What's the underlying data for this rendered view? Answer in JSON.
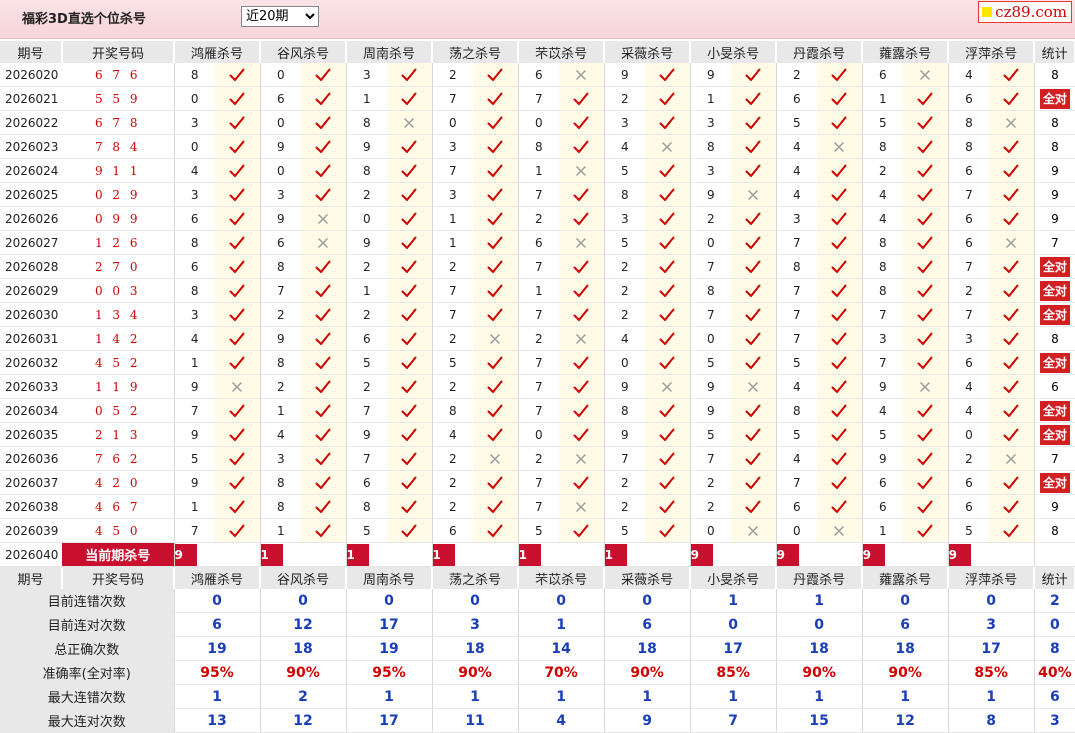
{
  "title": "福彩3D直选个位杀号",
  "period_select": {
    "selected": "近20期",
    "options": [
      "近20期"
    ]
  },
  "logo": {
    "text": "cz89.com"
  },
  "columns": {
    "issue": "期号",
    "draw": "开奖号码",
    "experts": [
      "鸿雁杀号",
      "谷风杀号",
      "周南杀号",
      "荡之杀号",
      "芣苡杀号",
      "采薇杀号",
      "小旻杀号",
      "丹霞杀号",
      "蕹露杀号",
      "浮萍杀号"
    ],
    "stat": "统计"
  },
  "rows": [
    {
      "issue": "2026020",
      "draw": "6 7 6",
      "kills": [
        8,
        0,
        3,
        2,
        6,
        9,
        9,
        2,
        6,
        4
      ],
      "ok": [
        1,
        1,
        1,
        1,
        0,
        1,
        1,
        1,
        0,
        1
      ],
      "stat": "8"
    },
    {
      "issue": "2026021",
      "draw": "5 5 9",
      "kills": [
        0,
        6,
        1,
        7,
        7,
        2,
        1,
        6,
        1,
        6
      ],
      "ok": [
        1,
        1,
        1,
        1,
        1,
        1,
        1,
        1,
        1,
        1
      ],
      "stat": "全对"
    },
    {
      "issue": "2026022",
      "draw": "6 7 8",
      "kills": [
        3,
        0,
        8,
        0,
        0,
        3,
        3,
        5,
        5,
        8
      ],
      "ok": [
        1,
        1,
        0,
        1,
        1,
        1,
        1,
        1,
        1,
        0
      ],
      "stat": "8"
    },
    {
      "issue": "2026023",
      "draw": "7 8 4",
      "kills": [
        0,
        9,
        9,
        3,
        8,
        4,
        8,
        4,
        8,
        8
      ],
      "ok": [
        1,
        1,
        1,
        1,
        1,
        0,
        1,
        0,
        1,
        1
      ],
      "stat": "8"
    },
    {
      "issue": "2026024",
      "draw": "9 1 1",
      "kills": [
        4,
        0,
        8,
        7,
        1,
        5,
        3,
        4,
        2,
        6
      ],
      "ok": [
        1,
        1,
        1,
        1,
        0,
        1,
        1,
        1,
        1,
        1
      ],
      "stat": "9"
    },
    {
      "issue": "2026025",
      "draw": "0 2 9",
      "kills": [
        3,
        3,
        2,
        3,
        7,
        8,
        9,
        4,
        4,
        7
      ],
      "ok": [
        1,
        1,
        1,
        1,
        1,
        1,
        0,
        1,
        1,
        1
      ],
      "stat": "9"
    },
    {
      "issue": "2026026",
      "draw": "0 9 9",
      "kills": [
        6,
        9,
        0,
        1,
        2,
        3,
        2,
        3,
        4,
        6
      ],
      "ok": [
        1,
        0,
        1,
        1,
        1,
        1,
        1,
        1,
        1,
        1
      ],
      "stat": "9"
    },
    {
      "issue": "2026027",
      "draw": "1 2 6",
      "kills": [
        8,
        6,
        9,
        1,
        6,
        5,
        0,
        7,
        8,
        6
      ],
      "ok": [
        1,
        0,
        1,
        1,
        0,
        1,
        1,
        1,
        1,
        0
      ],
      "stat": "7"
    },
    {
      "issue": "2026028",
      "draw": "2 7 0",
      "kills": [
        6,
        8,
        2,
        2,
        7,
        2,
        7,
        8,
        8,
        7
      ],
      "ok": [
        1,
        1,
        1,
        1,
        1,
        1,
        1,
        1,
        1,
        1
      ],
      "stat": "全对"
    },
    {
      "issue": "2026029",
      "draw": "0 0 3",
      "kills": [
        8,
        7,
        1,
        7,
        1,
        2,
        8,
        7,
        8,
        2
      ],
      "ok": [
        1,
        1,
        1,
        1,
        1,
        1,
        1,
        1,
        1,
        1
      ],
      "stat": "全对"
    },
    {
      "issue": "2026030",
      "draw": "1 3 4",
      "kills": [
        3,
        2,
        2,
        7,
        7,
        2,
        7,
        7,
        7,
        7
      ],
      "ok": [
        1,
        1,
        1,
        1,
        1,
        1,
        1,
        1,
        1,
        1
      ],
      "stat": "全对"
    },
    {
      "issue": "2026031",
      "draw": "1 4 2",
      "kills": [
        4,
        9,
        6,
        2,
        2,
        4,
        0,
        7,
        3,
        3
      ],
      "ok": [
        1,
        1,
        1,
        0,
        0,
        1,
        1,
        1,
        1,
        1
      ],
      "stat": "8"
    },
    {
      "issue": "2026032",
      "draw": "4 5 2",
      "kills": [
        1,
        8,
        5,
        5,
        7,
        0,
        5,
        5,
        7,
        6
      ],
      "ok": [
        1,
        1,
        1,
        1,
        1,
        1,
        1,
        1,
        1,
        1
      ],
      "stat": "全对"
    },
    {
      "issue": "2026033",
      "draw": "1 1 9",
      "kills": [
        9,
        2,
        2,
        2,
        7,
        9,
        9,
        4,
        9,
        4
      ],
      "ok": [
        0,
        1,
        1,
        1,
        1,
        0,
        0,
        1,
        0,
        1
      ],
      "stat": "6"
    },
    {
      "issue": "2026034",
      "draw": "0 5 2",
      "kills": [
        7,
        1,
        7,
        8,
        7,
        8,
        9,
        8,
        4,
        4
      ],
      "ok": [
        1,
        1,
        1,
        1,
        1,
        1,
        1,
        1,
        1,
        1
      ],
      "stat": "全对"
    },
    {
      "issue": "2026035",
      "draw": "2 1 3",
      "kills": [
        9,
        4,
        9,
        4,
        0,
        9,
        5,
        5,
        5,
        0
      ],
      "ok": [
        1,
        1,
        1,
        1,
        1,
        1,
        1,
        1,
        1,
        1
      ],
      "stat": "全对"
    },
    {
      "issue": "2026036",
      "draw": "7 6 2",
      "kills": [
        5,
        3,
        7,
        2,
        2,
        7,
        7,
        4,
        9,
        2
      ],
      "ok": [
        1,
        1,
        1,
        0,
        0,
        1,
        1,
        1,
        1,
        0
      ],
      "stat": "7"
    },
    {
      "issue": "2026037",
      "draw": "4 2 0",
      "kills": [
        9,
        8,
        6,
        2,
        7,
        2,
        2,
        7,
        6,
        6
      ],
      "ok": [
        1,
        1,
        1,
        1,
        1,
        1,
        1,
        1,
        1,
        1
      ],
      "stat": "全对"
    },
    {
      "issue": "2026038",
      "draw": "4 6 7",
      "kills": [
        1,
        8,
        8,
        2,
        7,
        2,
        2,
        6,
        6,
        6
      ],
      "ok": [
        1,
        1,
        1,
        1,
        0,
        1,
        1,
        1,
        1,
        1
      ],
      "stat": "9"
    },
    {
      "issue": "2026039",
      "draw": "4 5 0",
      "kills": [
        7,
        1,
        5,
        6,
        5,
        5,
        0,
        0,
        1,
        5
      ],
      "ok": [
        1,
        1,
        1,
        1,
        1,
        1,
        0,
        0,
        1,
        1
      ],
      "stat": "8"
    }
  ],
  "current": {
    "issue": "2026040",
    "label": "当前期杀号",
    "kills": [
      "9",
      "1",
      "1",
      "1",
      "1",
      "1",
      "9",
      "9",
      "9",
      "9"
    ]
  },
  "summary": {
    "rows": [
      {
        "label": "目前连错次数",
        "values": [
          "0",
          "0",
          "0",
          "0",
          "0",
          "0",
          "1",
          "1",
          "0",
          "0"
        ],
        "stat": "2"
      },
      {
        "label": "目前连对次数",
        "values": [
          "6",
          "12",
          "17",
          "3",
          "1",
          "6",
          "0",
          "0",
          "6",
          "3"
        ],
        "stat": "0"
      },
      {
        "label": "总正确次数",
        "values": [
          "19",
          "18",
          "19",
          "18",
          "14",
          "18",
          "17",
          "18",
          "18",
          "17"
        ],
        "stat": "8"
      },
      {
        "label": "准确率(全对率)",
        "values": [
          "95%",
          "90%",
          "95%",
          "90%",
          "70%",
          "90%",
          "85%",
          "90%",
          "90%",
          "85%"
        ],
        "stat": "40%",
        "highlight": true
      },
      {
        "label": "最大连错次数",
        "values": [
          "1",
          "2",
          "1",
          "1",
          "1",
          "1",
          "1",
          "1",
          "1",
          "1"
        ],
        "stat": "6"
      },
      {
        "label": "最大连对次数",
        "values": [
          "13",
          "12",
          "17",
          "11",
          "4",
          "9",
          "7",
          "15",
          "12",
          "8"
        ],
        "stat": "3"
      }
    ]
  },
  "colors": {
    "accent_red": "#d20000",
    "label_red": "#c8102e",
    "blue": "#1a3eb8",
    "mark_bg": "#fffbe6",
    "header_bg": "#e8e8e8"
  }
}
